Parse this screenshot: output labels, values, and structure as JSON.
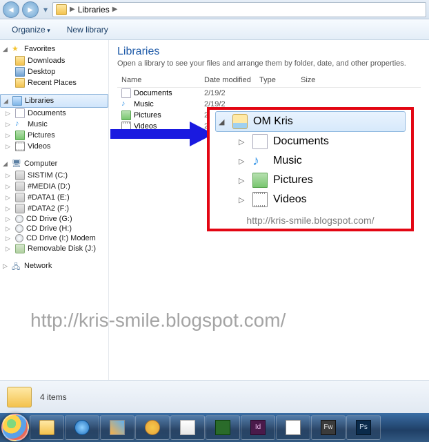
{
  "titlebar": {
    "crumb0": "Libraries"
  },
  "toolbar": {
    "organize": "Organize",
    "newlib": "New library"
  },
  "nav": {
    "favorites": "Favorites",
    "fav": {
      "downloads": "Downloads",
      "desktop": "Desktop",
      "recent": "Recent Places"
    },
    "libraries": "Libraries",
    "lib": {
      "documents": "Documents",
      "music": "Music",
      "pictures": "Pictures",
      "videos": "Videos"
    },
    "computer": "Computer",
    "drv": {
      "c": "SISTIM (C:)",
      "d": "#MEDIA (D:)",
      "e": "#DATA1 (E:)",
      "f": "#DATA2 (F:)",
      "g": "CD Drive (G:)",
      "h": "CD Drive (H:)",
      "i": "CD Drive (I:) Modem",
      "j": "Removable Disk (J:)"
    },
    "network": "Network"
  },
  "content": {
    "title": "Libraries",
    "sub": "Open a library to see your files and arrange them by folder, date, and other properties.",
    "cols": {
      "name": "Name",
      "date": "Date modified",
      "type": "Type",
      "size": "Size"
    },
    "rows": [
      {
        "name": "Documents",
        "date": "2/19/2"
      },
      {
        "name": "Music",
        "date": "2/19/2"
      },
      {
        "name": "Pictures",
        "date": "2/19/2"
      },
      {
        "name": "Videos",
        "date": "2/19/2"
      }
    ]
  },
  "callout": {
    "root": "OM Kris",
    "items": {
      "documents": "Documents",
      "music": "Music",
      "pictures": "Pictures",
      "videos": "Videos"
    },
    "url": "http://kris-smile.blogspot.com/"
  },
  "watermark": "http://kris-smile.blogspot.com/",
  "status": "4 items"
}
